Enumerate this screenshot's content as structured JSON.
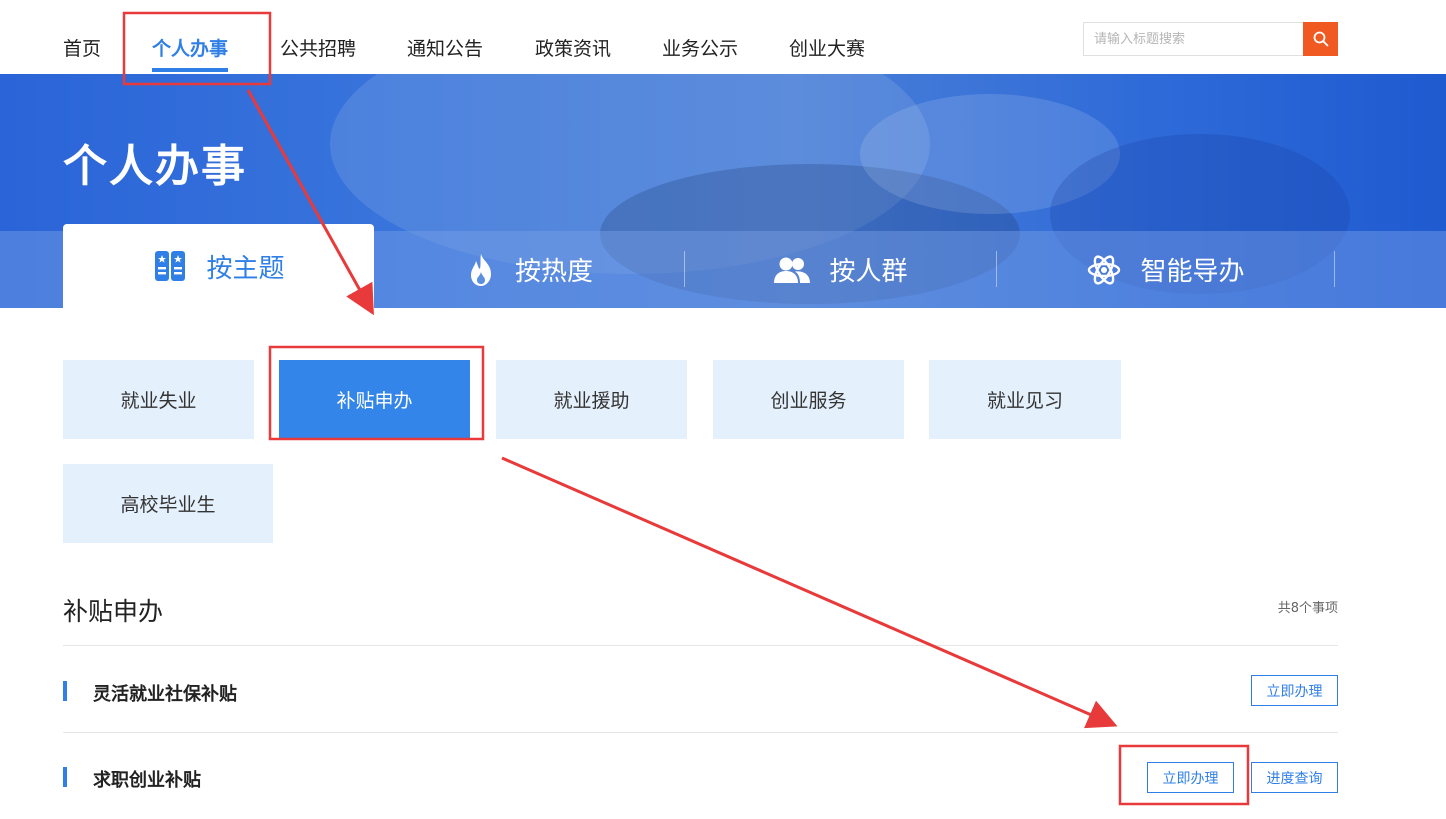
{
  "nav": {
    "items": [
      "首页",
      "个人办事",
      "公共招聘",
      "通知公告",
      "政策资讯",
      "业务公示",
      "创业大赛"
    ],
    "active_index": 1
  },
  "search": {
    "placeholder": "请输入标题搜索",
    "icon": "search-icon"
  },
  "banner": {
    "title": "个人办事",
    "tabs": [
      {
        "label": "按主题",
        "icon": "theme-book-icon"
      },
      {
        "label": "按热度",
        "icon": "flame-icon"
      },
      {
        "label": "按人群",
        "icon": "people-icon"
      },
      {
        "label": "智能导办",
        "icon": "atom-icon"
      }
    ],
    "active_tab": 0
  },
  "categories": [
    "就业失业",
    "补贴申办",
    "就业援助",
    "创业服务",
    "就业见习",
    "高校毕业生"
  ],
  "active_category": 1,
  "section": {
    "title": "补贴申办",
    "count": "共8个事项",
    "items": [
      {
        "title": "灵活就业社保补贴",
        "actions": [
          "立即办理"
        ]
      },
      {
        "title": "求职创业补贴",
        "actions": [
          "立即办理",
          "进度查询"
        ]
      }
    ]
  },
  "colors": {
    "accent": "#2f7fe6",
    "search_button": "#f05a22",
    "category_bg": "#e4f0fc",
    "category_active": "#3385ea",
    "annotation": "#e83a3a"
  }
}
